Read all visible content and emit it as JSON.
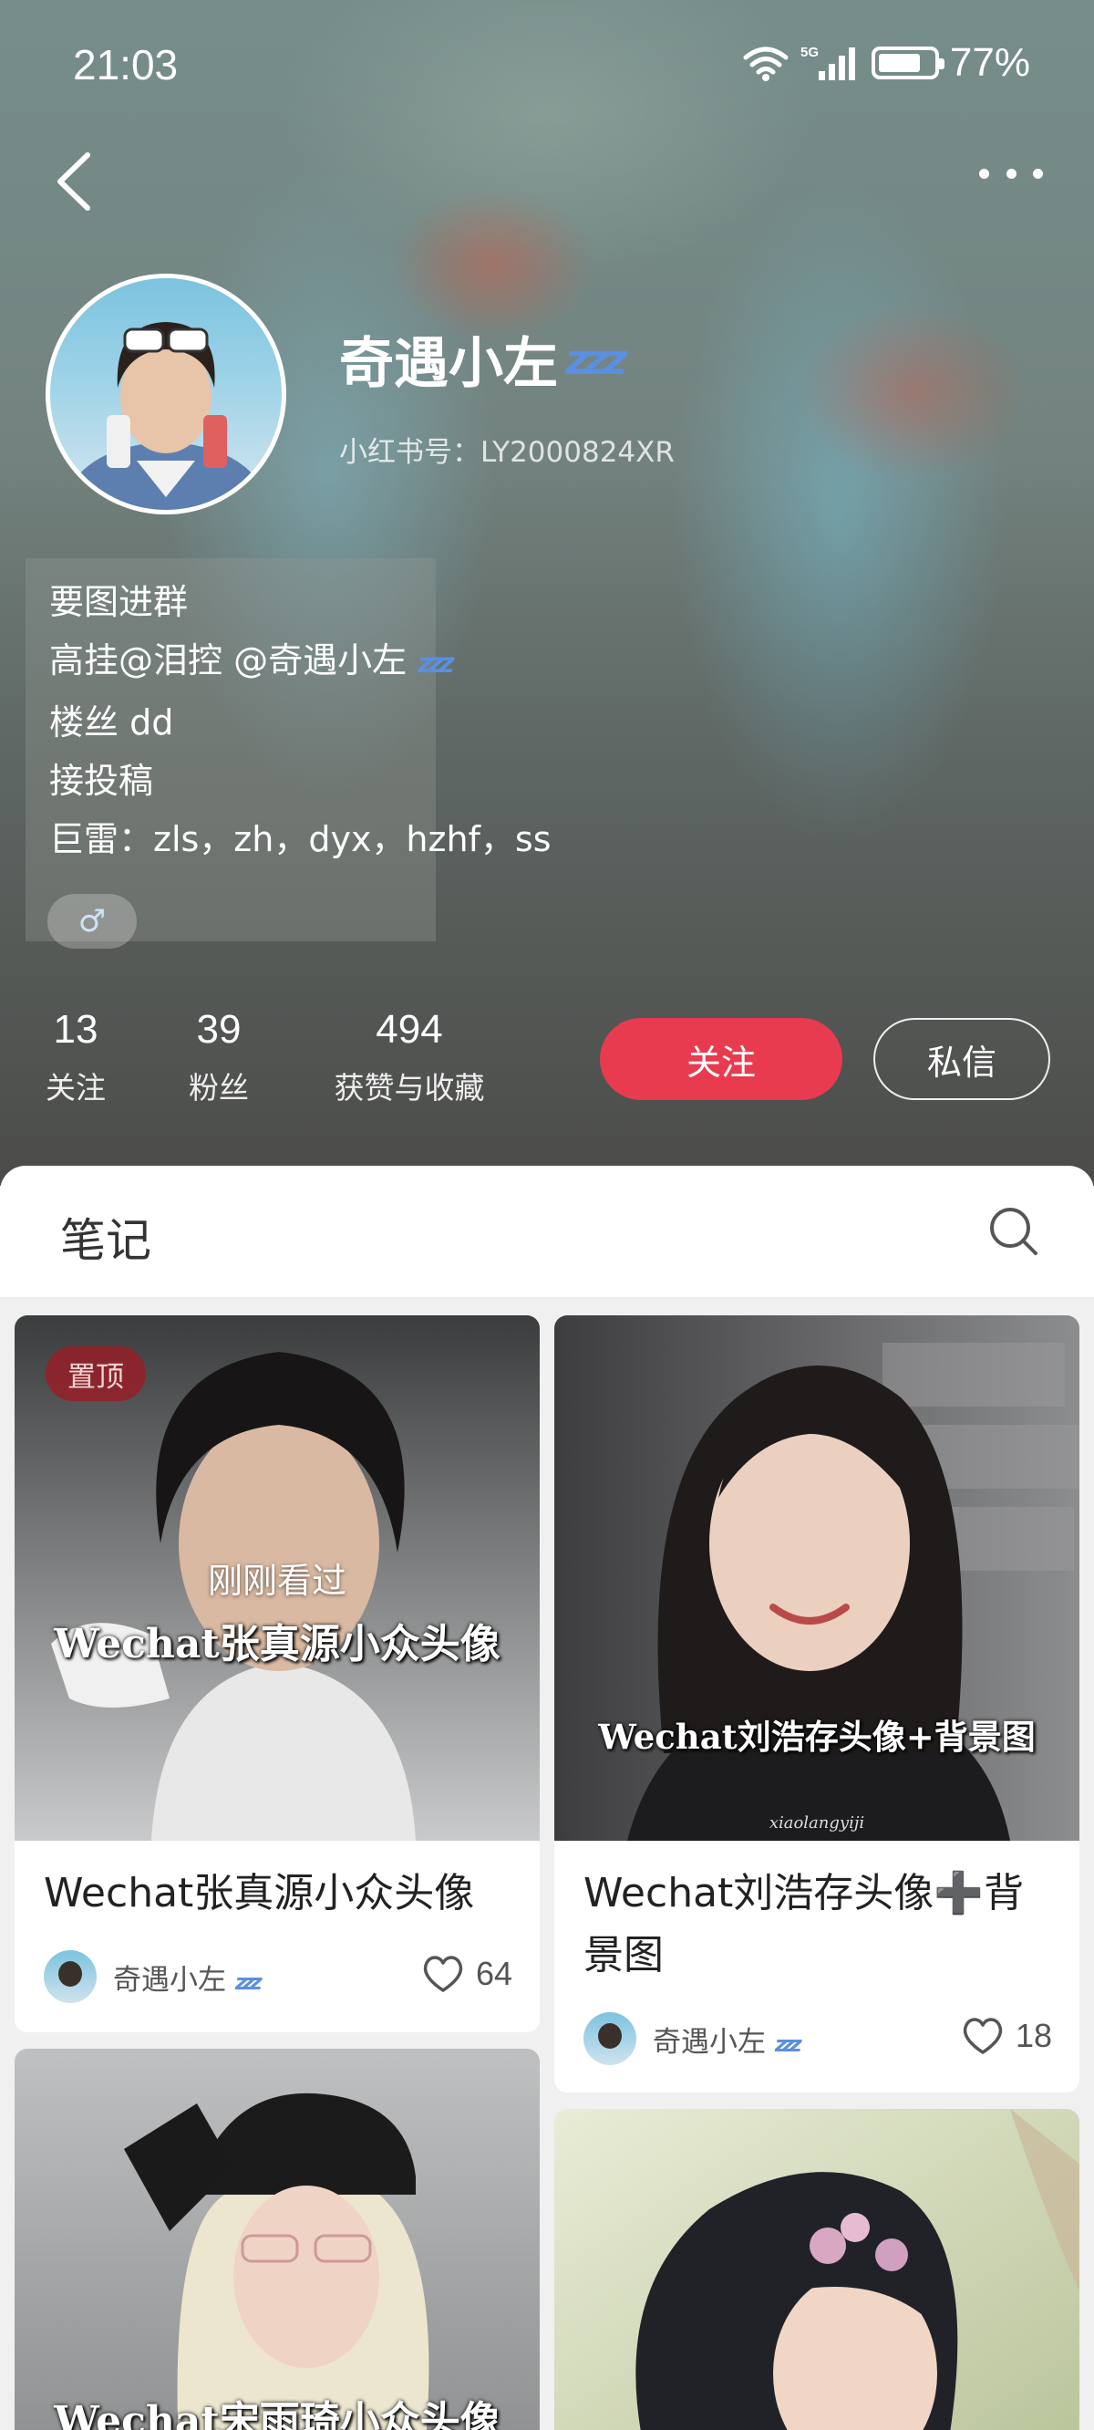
{
  "status_bar": {
    "time": "21:03",
    "network": "5G",
    "battery_percent": "77%",
    "battery_level": 0.77
  },
  "profile": {
    "nickname": "奇遇小左",
    "nickname_emoji": "💤",
    "red_id": "小红书号：LY2000824XR",
    "bio_lines": [
      "要图进群",
      "高挂@泪控 @奇遇小左",
      "楼丝 dd",
      "接投稿",
      "巨雷：zls，zh，dyx，hzhf，ss"
    ],
    "gender_symbol": "♂",
    "stats": [
      {
        "value": "13",
        "label": "关注"
      },
      {
        "value": "39",
        "label": "粉丝"
      },
      {
        "value": "494",
        "label": "获赞与收藏"
      }
    ],
    "follow_label": "关注",
    "message_label": "私信"
  },
  "tabs": {
    "notes_label": "笔记"
  },
  "notes": [
    {
      "title": "Wechat张真源小众头像",
      "author": "奇遇小左",
      "likes": "64",
      "pin_label": "置顶",
      "just_viewed_label": "刚刚看过",
      "overlay": "Wechat张真源小众头像"
    },
    {
      "title": "Wechat刘浩存头像➕背景图",
      "author": "奇遇小左",
      "likes": "18",
      "overlay": "Wechat刘浩存头像+背景图",
      "watermark": "xiaolangyiji"
    },
    {
      "overlay": "Wechat宋雨琦小众头像"
    },
    {}
  ],
  "colors": {
    "accent_red": "#e83b4f",
    "pin_badge": "#961e28",
    "zzz_blue": "#5b8fe0"
  }
}
